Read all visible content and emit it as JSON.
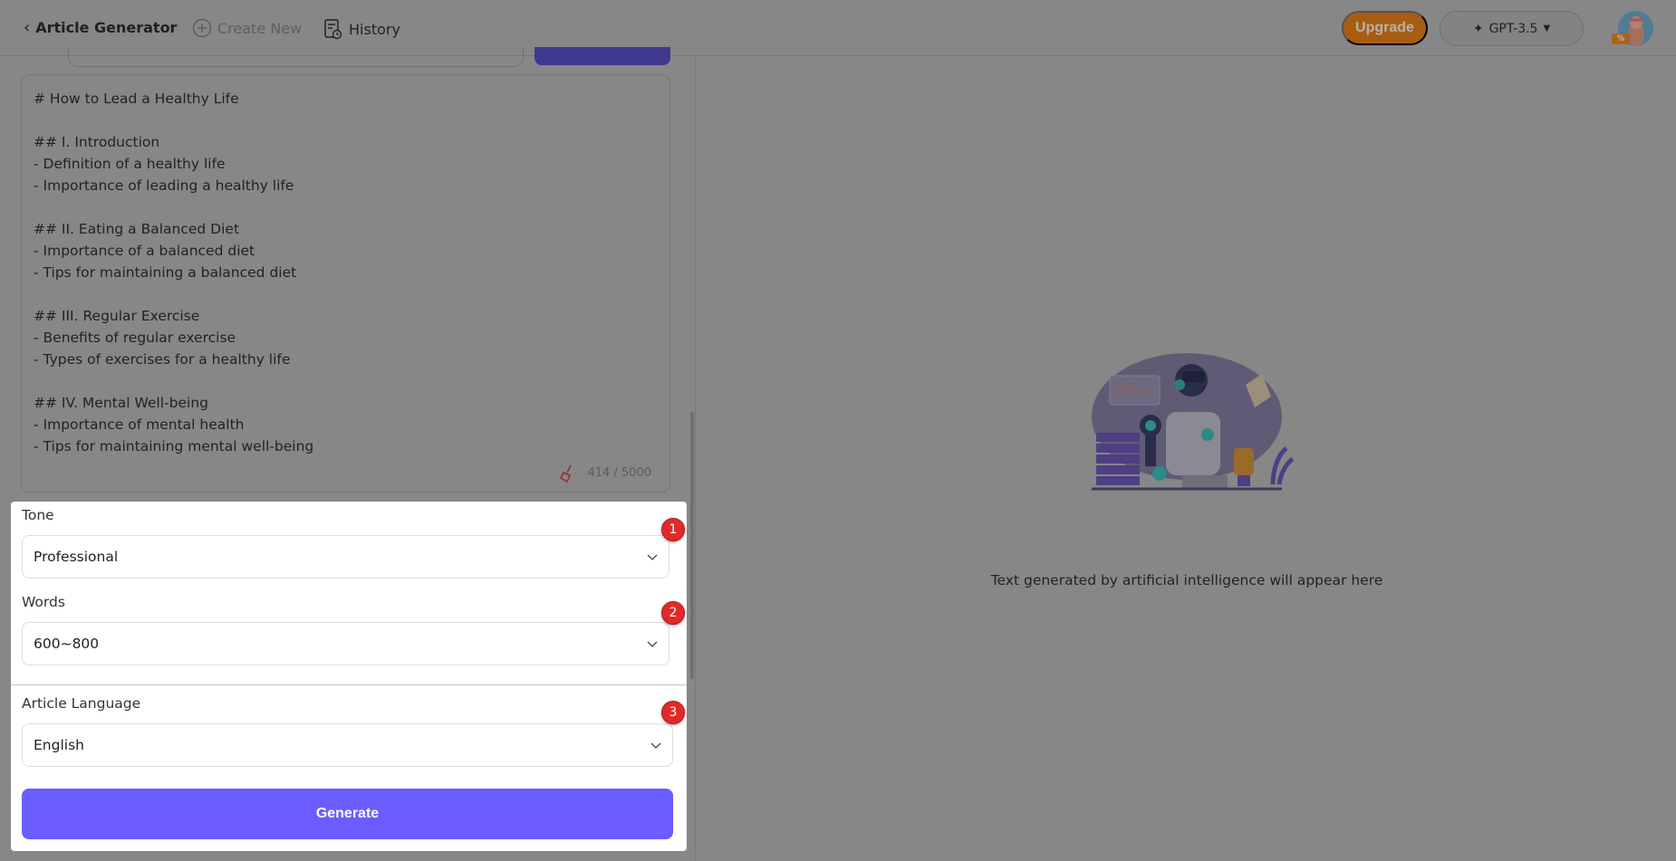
{
  "header": {
    "title": "Article Generator",
    "create_new": "Create New",
    "history": "History",
    "upgrade": "Upgrade",
    "model": "GPT-3.5",
    "avatar_badge": "%"
  },
  "editor": {
    "content": "# How to Lead a Healthy Life\n\n## I. Introduction\n- Definition of a healthy life\n- Importance of leading a healthy life\n\n## II. Eating a Balanced Diet\n- Importance of a balanced diet\n- Tips for maintaining a balanced diet\n\n## III. Regular Exercise\n- Benefits of regular exercise\n- Types of exercises for a healthy life\n\n## IV. Mental Well-being\n- Importance of mental health\n- Tips for maintaining mental well-being",
    "counter": "414 / 5000"
  },
  "form": {
    "tone_label": "Tone",
    "tone_value": "Professional",
    "words_label": "Words",
    "words_value": "600~800",
    "language_label": "Article Language",
    "language_value": "English",
    "generate": "Generate",
    "badges": [
      "1",
      "2",
      "3"
    ]
  },
  "output": {
    "placeholder": "Text generated by artificial intelligence will appear here"
  },
  "colors": {
    "accent": "#6a5cff",
    "upgrade": "#e07b1a",
    "badge": "#e02a2a"
  }
}
